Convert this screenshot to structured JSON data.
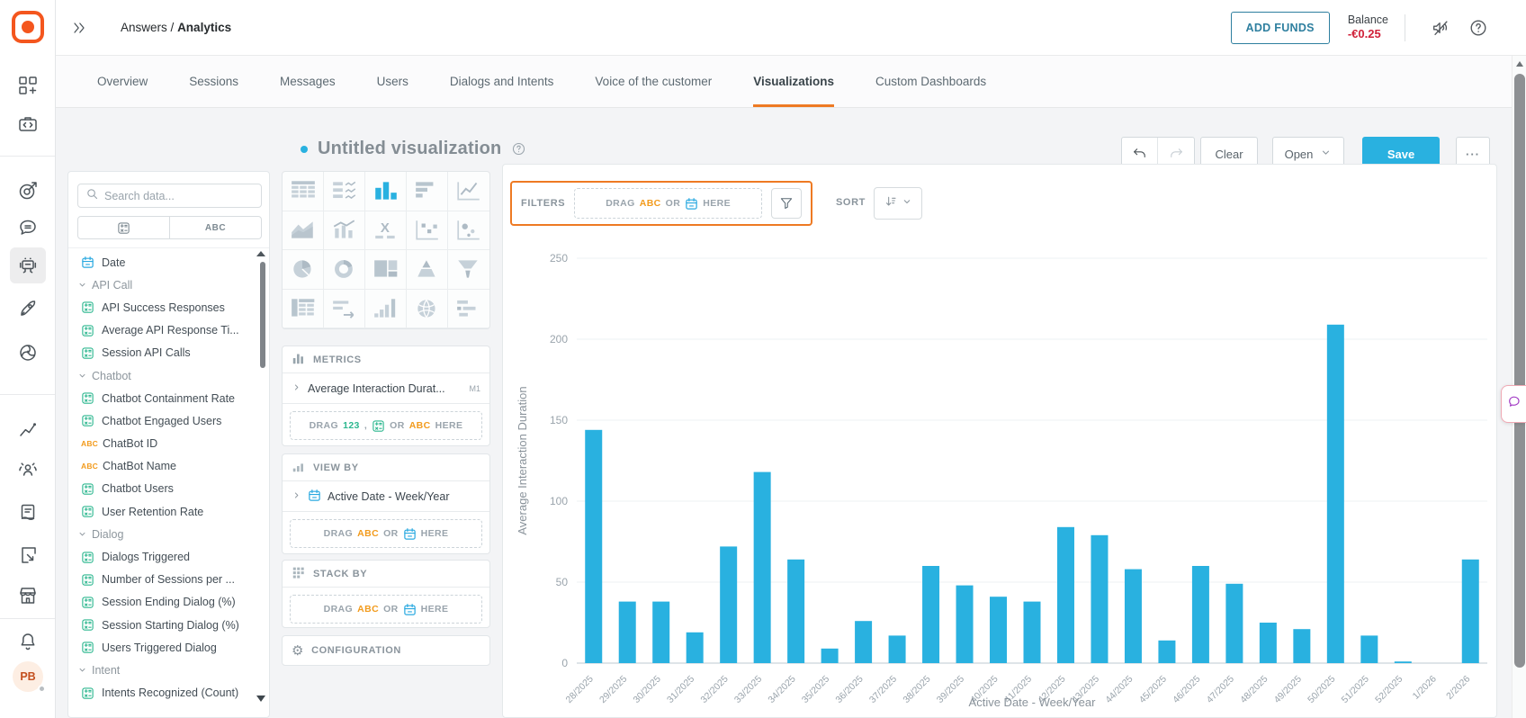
{
  "topbar": {
    "breadcrumb": {
      "section": "Answers",
      "separator": "/",
      "page": "Analytics"
    },
    "add_funds_label": "ADD FUNDS",
    "balance_label": "Balance",
    "balance_value": "-€0.25"
  },
  "tabs": {
    "items": [
      "Overview",
      "Sessions",
      "Messages",
      "Users",
      "Dialogs and Intents",
      "Voice of the customer",
      "Visualizations",
      "Custom Dashboards"
    ],
    "active": "Visualizations"
  },
  "toolbar": {
    "title": "Untitled visualization",
    "clear_label": "Clear",
    "open_label": "Open",
    "save_label": "Save",
    "more_label": "···"
  },
  "sidebar": {
    "top_icons": [
      {
        "name": "apps-icon"
      },
      {
        "name": "dev-tools-icon"
      }
    ],
    "product_icons": [
      {
        "name": "moments-target-icon"
      },
      {
        "name": "conversations-icon"
      },
      {
        "name": "answers-chatbot-icon",
        "active": true
      },
      {
        "name": "launch-rocket-icon"
      },
      {
        "name": "channels-icon"
      }
    ],
    "tool_icons": [
      {
        "name": "analytics-icon"
      },
      {
        "name": "audience-icon"
      },
      {
        "name": "catalog-icon"
      },
      {
        "name": "flows-icon"
      },
      {
        "name": "marketplace-icon"
      }
    ],
    "bell_icon": "notifications-icon",
    "avatar_initials": "PB"
  },
  "data_panel": {
    "search_placeholder": "Search data...",
    "type_toggle": {
      "left_icon": "measure-filter-icon",
      "right_label": "ABC"
    },
    "fields": [
      {
        "kind": "field",
        "icon": "calendar",
        "label": "Date"
      },
      {
        "kind": "group",
        "label": "API Call"
      },
      {
        "kind": "field",
        "icon": "measure",
        "label": "API Success Responses"
      },
      {
        "kind": "field",
        "icon": "measure",
        "label": "Average API Response Ti..."
      },
      {
        "kind": "field",
        "icon": "measure",
        "label": "Session API Calls"
      },
      {
        "kind": "group",
        "label": "Chatbot"
      },
      {
        "kind": "field",
        "icon": "measure",
        "label": "Chatbot Containment Rate"
      },
      {
        "kind": "field",
        "icon": "measure",
        "label": "Chatbot Engaged Users"
      },
      {
        "kind": "field",
        "icon": "text",
        "label": "ChatBot ID"
      },
      {
        "kind": "field",
        "icon": "text",
        "label": "ChatBot Name"
      },
      {
        "kind": "field",
        "icon": "measure",
        "label": "Chatbot Users"
      },
      {
        "kind": "field",
        "icon": "measure",
        "label": "User Retention Rate"
      },
      {
        "kind": "group",
        "label": "Dialog"
      },
      {
        "kind": "field",
        "icon": "measure",
        "label": "Dialogs Triggered"
      },
      {
        "kind": "field",
        "icon": "measure",
        "label": "Number of Sessions per ..."
      },
      {
        "kind": "field",
        "icon": "measure",
        "label": "Session Ending Dialog (%)"
      },
      {
        "kind": "field",
        "icon": "measure",
        "label": "Session Starting Dialog (%)"
      },
      {
        "kind": "field",
        "icon": "measure",
        "label": "Users Triggered Dialog"
      },
      {
        "kind": "group",
        "label": "Intent"
      },
      {
        "kind": "field",
        "icon": "measure",
        "label": "Intents Recognized (Count)"
      }
    ]
  },
  "builder": {
    "chart_types": {
      "selected": "bar-vertical",
      "cells": [
        "table",
        "table-sparkline",
        "bar-vertical",
        "bar-horizontal",
        "line",
        "area",
        "combo",
        "number",
        "scatter",
        "bubble",
        "pie",
        "donut",
        "treemap",
        "pyramid",
        "funnel",
        "pivot-table",
        "progress",
        "waterfall",
        "geo-map",
        "gantt"
      ]
    },
    "metrics": {
      "header": "METRICS",
      "item_label": "Average Interaction Durat...",
      "item_badge": "M1",
      "drop_tokens": [
        {
          "text": "DRAG"
        },
        {
          "text": "123",
          "color": "green"
        },
        {
          "text": ","
        },
        {
          "icon": "measure",
          "color": "green"
        },
        {
          "text": "OR"
        },
        {
          "text": "ABC",
          "color": "orange"
        },
        {
          "text": "HERE"
        }
      ]
    },
    "view_by": {
      "header": "VIEW BY",
      "item_label": "Active Date - Week/Year",
      "item_icon": "calendar",
      "drop_tokens": [
        {
          "text": "DRAG"
        },
        {
          "text": "ABC",
          "color": "orange"
        },
        {
          "text": "OR"
        },
        {
          "icon": "calendar",
          "color": "blue"
        },
        {
          "text": "HERE"
        }
      ]
    },
    "stack_by": {
      "header": "STACK BY",
      "drop_tokens": [
        {
          "text": "DRAG"
        },
        {
          "text": "ABC",
          "color": "orange"
        },
        {
          "text": "OR"
        },
        {
          "icon": "calendar",
          "color": "blue"
        },
        {
          "text": "HERE"
        }
      ]
    },
    "configuration": {
      "header": "CONFIGURATION"
    }
  },
  "filters": {
    "label": "FILTERS",
    "drop_tokens": [
      {
        "text": "DRAG"
      },
      {
        "text": "ABC",
        "color": "orange"
      },
      {
        "text": "OR"
      },
      {
        "icon": "calendar",
        "color": "blue"
      },
      {
        "text": "HERE"
      }
    ],
    "highlight_color": "#ee7a23"
  },
  "sort": {
    "label": "SORT"
  },
  "chart_data": {
    "type": "bar",
    "title": "Untitled visualization",
    "xlabel": "Active Date - Week/Year",
    "ylabel": "Average Interaction Duration",
    "ylim": [
      0,
      250
    ],
    "yticks": [
      0,
      50,
      100,
      150,
      200,
      250
    ],
    "grid": true,
    "legend": "none",
    "bar_color": "#29b1e0",
    "categories": [
      "28/2025",
      "29/2025",
      "30/2025",
      "31/2025",
      "32/2025",
      "33/2025",
      "34/2025",
      "35/2025",
      "36/2025",
      "37/2025",
      "38/2025",
      "39/2025",
      "40/2025",
      "41/2025",
      "42/2025",
      "43/2025",
      "44/2025",
      "45/2025",
      "46/2025",
      "47/2025",
      "48/2025",
      "49/2025",
      "50/2025",
      "51/2025",
      "52/2025",
      "1/2026",
      "2/2026"
    ],
    "values": [
      144,
      38,
      38,
      19,
      72,
      118,
      64,
      9,
      26,
      17,
      60,
      48,
      41,
      38,
      84,
      79,
      58,
      14,
      60,
      49,
      25,
      21,
      209,
      17,
      1,
      0,
      64
    ]
  },
  "colors": {
    "accent_orange": "#ee7a23",
    "brand_orange": "#f4561e",
    "primary_blue": "#29b1e0",
    "measure_green": "#2db78f",
    "text_field_orange": "#f29b1d",
    "calendar_blue": "#2aa9e0",
    "danger_red": "#d02139"
  }
}
